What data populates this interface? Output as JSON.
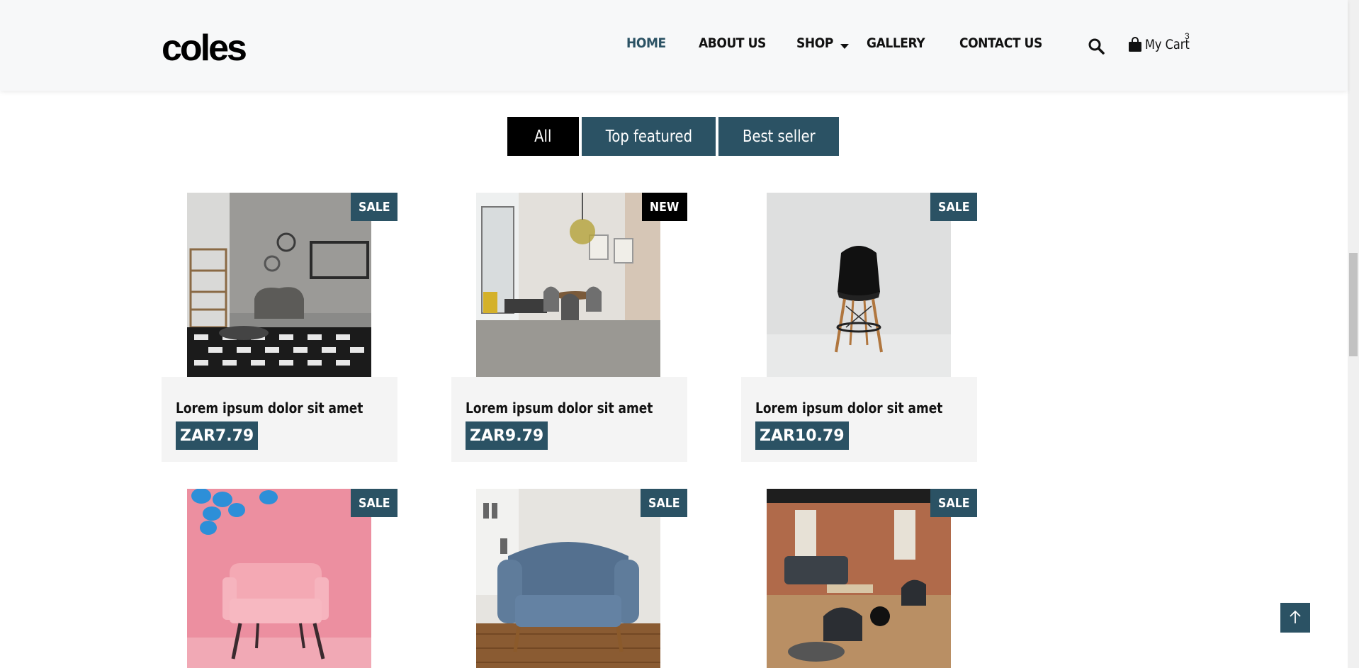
{
  "header": {
    "logo": "coles",
    "nav": [
      {
        "label": "HOME",
        "active": true
      },
      {
        "label": "ABOUT US",
        "active": false
      },
      {
        "label": "SHOP",
        "active": false
      },
      {
        "label": "GALLERY",
        "active": false
      },
      {
        "label": "CONTACT US",
        "active": false
      }
    ],
    "cart": {
      "label": "My Cart",
      "count": "3"
    }
  },
  "filters": {
    "all": "All",
    "top_featured": "Top featured",
    "best_seller": "Best seller",
    "selected": "All"
  },
  "products": [
    {
      "badge": "SALE",
      "title": "Lorem ipsum dolor sit amet",
      "price": "ZAR7.79",
      "image": "living-room-armchair"
    },
    {
      "badge": "NEW",
      "title": "Lorem ipsum dolor sit amet",
      "price": "ZAR9.79",
      "image": "dining-room"
    },
    {
      "badge": "SALE",
      "title": "Lorem ipsum dolor sit amet",
      "price": "ZAR10.79",
      "image": "black-chair"
    },
    {
      "badge": "SALE",
      "image": "pink-armchair"
    },
    {
      "badge": "SALE",
      "image": "blue-armchair"
    },
    {
      "badge": "SALE",
      "image": "lounge-sofas"
    }
  ],
  "colors": {
    "accent": "#2b5264",
    "tab_active": "#000000",
    "header_bg": "#f7f8f9",
    "card_bg": "#f4f4f4"
  },
  "icons": [
    "search-icon",
    "shopping-bag-icon",
    "chevron-down-icon",
    "arrow-up-icon"
  ]
}
